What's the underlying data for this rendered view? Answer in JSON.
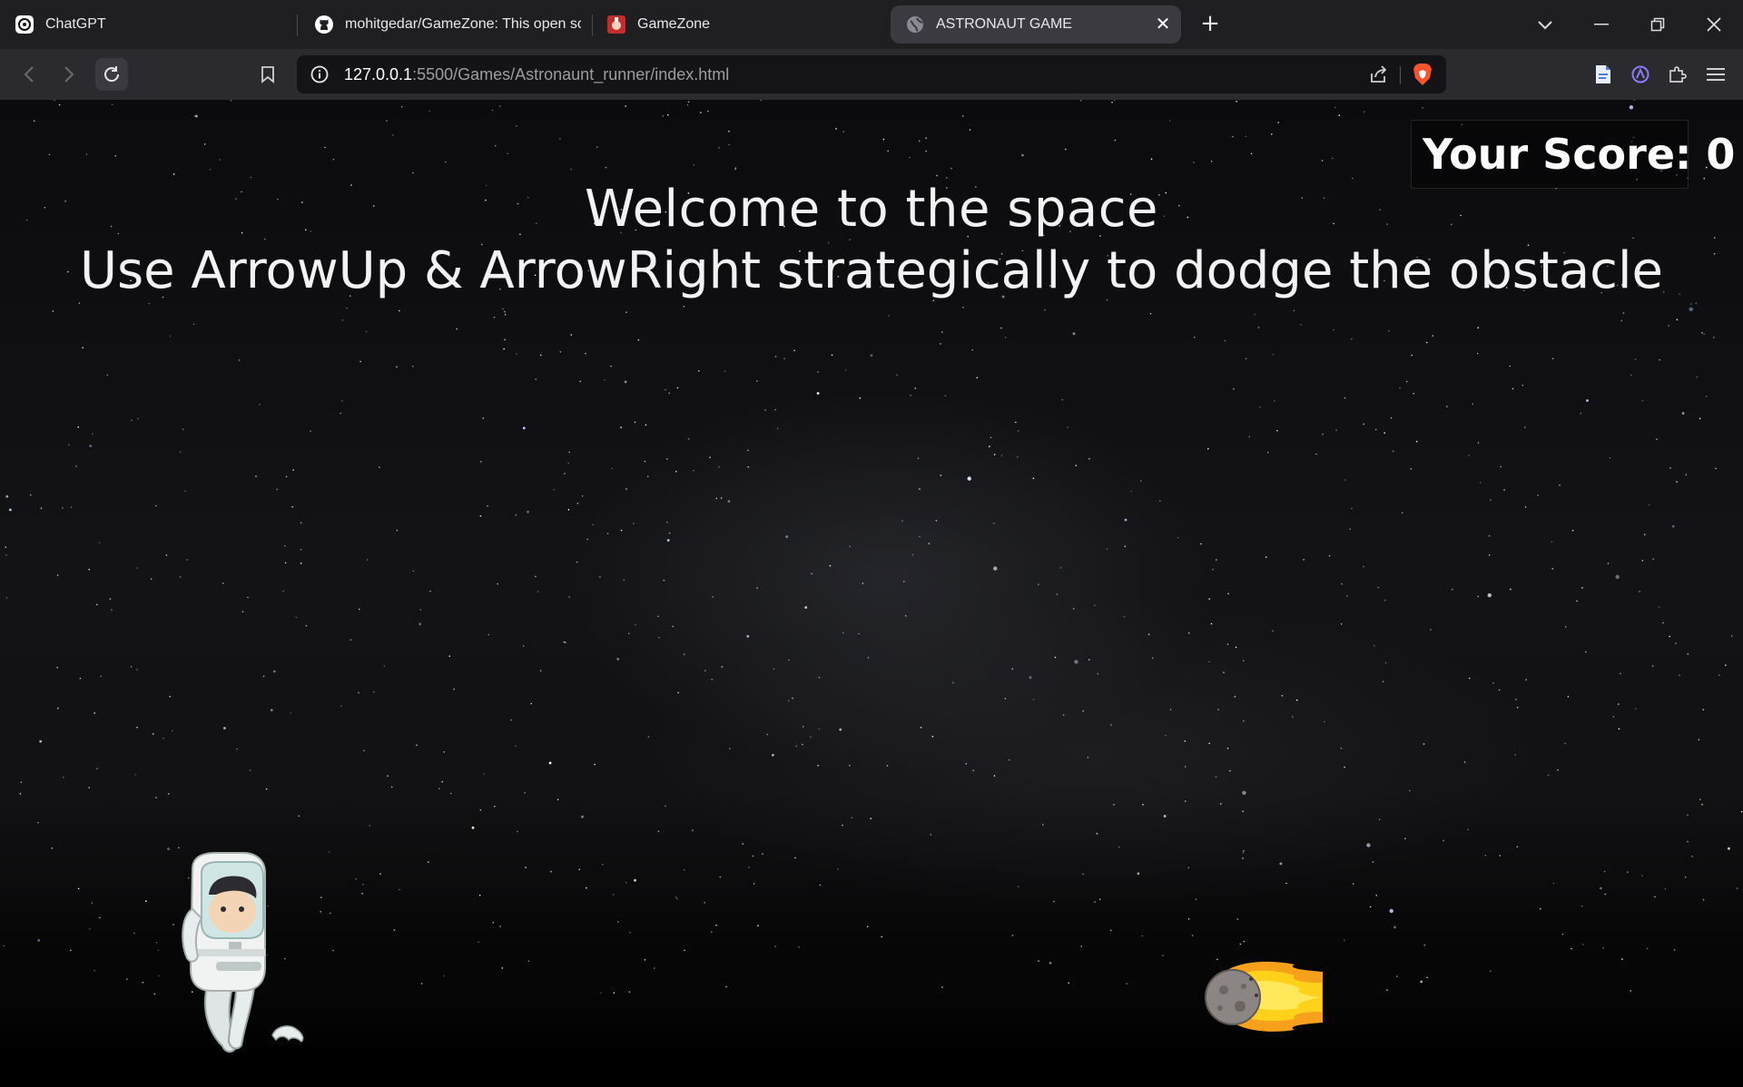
{
  "browser": {
    "tabs": [
      {
        "label": "ChatGPT",
        "icon": "chatgpt-icon"
      },
      {
        "label": "mohitgedar/GameZone: This open sc",
        "icon": "github-icon"
      },
      {
        "label": "GameZone",
        "icon": "gamezone-icon"
      },
      {
        "label": "ASTRONAUT GAME",
        "icon": "globe-icon",
        "active": true
      }
    ],
    "url": {
      "host": "127.0.0.1",
      "rest": ":5500/Games/Astronaunt_runner/index.html"
    }
  },
  "game": {
    "welcome": "Welcome to the space",
    "instructions": "Use ArrowUp & ArrowRight strategically to dodge the obstacle",
    "score_label": "Your Score: 0"
  },
  "colors": {
    "tabbar": "#1f1f22",
    "toolbar": "#2b2b2f",
    "active_tab": "#3a3a40",
    "brave_orange": "#fb542b",
    "space_bg": "#0b0b0d",
    "text": "#f2f2f2"
  }
}
